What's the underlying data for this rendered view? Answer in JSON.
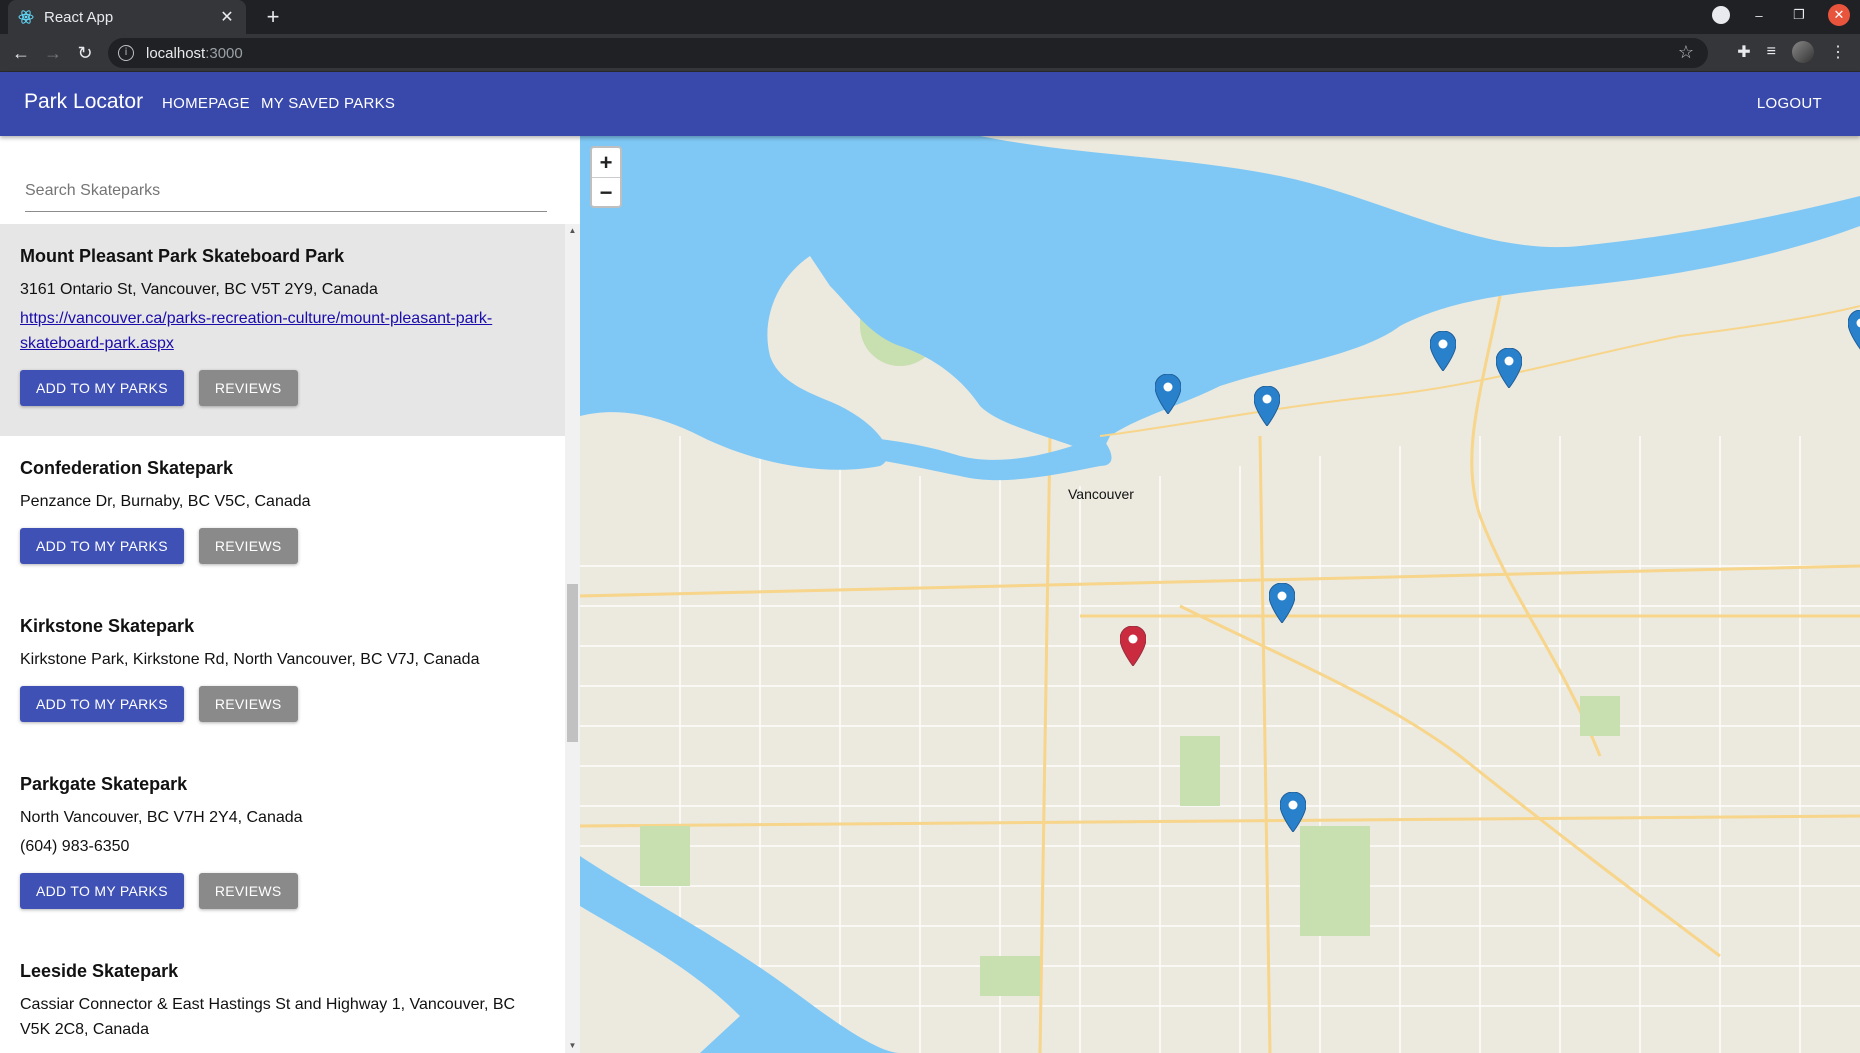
{
  "browser": {
    "tab_title": "React App",
    "url_host": "localhost",
    "url_port": ":3000"
  },
  "appbar": {
    "brand": "Park Locator",
    "nav": [
      "HOMEPAGE",
      "MY SAVED PARKS"
    ],
    "logout": "LOGOUT",
    "color": "#3949ab"
  },
  "search": {
    "placeholder": "Search Skateparks"
  },
  "buttons": {
    "add": "ADD TO MY PARKS",
    "reviews": "REVIEWS"
  },
  "parks": [
    {
      "name": "Mount Pleasant Park Skateboard Park",
      "address": "3161 Ontario St, Vancouver, BC V5T 2Y9, Canada",
      "url": "https://vancouver.ca/parks-recreation-culture/mount-pleasant-park-skateboard-park.aspx",
      "selected": true
    },
    {
      "name": "Confederation Skatepark",
      "address": "Penzance Dr, Burnaby, BC V5C, Canada"
    },
    {
      "name": "Kirkstone Skatepark",
      "address": "Kirkstone Park, Kirkstone Rd, North Vancouver, BC V7J, Canada"
    },
    {
      "name": "Parkgate Skatepark",
      "address": "North Vancouver, BC V7H 2Y4, Canada",
      "phone": "(604) 983-6350"
    },
    {
      "name": "Leeside Skatepark",
      "address": "Cassiar Connector & East Hastings St and Highway 1, Vancouver, BC V5K 2C8, Canada"
    }
  ],
  "map": {
    "city_label": "Vancouver",
    "zoom_in": "+",
    "zoom_out": "−",
    "water_color": "#7fc8f5",
    "land_color": "#ece9df",
    "marker_blue": "#2a81cb",
    "marker_red": "#cb2b3e"
  }
}
